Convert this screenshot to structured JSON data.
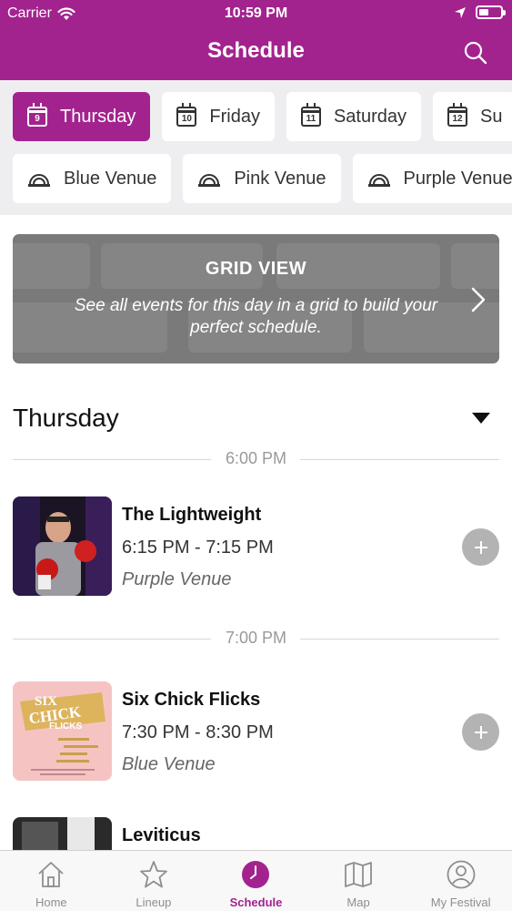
{
  "status_bar": {
    "carrier": "Carrier",
    "time": "10:59 PM",
    "battery_level": 0.45
  },
  "header": {
    "title": "Schedule"
  },
  "day_chips": [
    {
      "label": "Thursday",
      "day": "9",
      "active": true
    },
    {
      "label": "Friday",
      "day": "10",
      "active": false
    },
    {
      "label": "Saturday",
      "day": "11",
      "active": false
    },
    {
      "label": "Su",
      "day": "12",
      "active": false
    }
  ],
  "venue_chips": [
    {
      "label": "Blue Venue"
    },
    {
      "label": "Pink Venue"
    },
    {
      "label": "Purple Venue"
    }
  ],
  "grid_view": {
    "title": "GRID VIEW",
    "description": "See all events for this day in a grid to build your perfect schedule."
  },
  "day_section": {
    "title": "Thursday"
  },
  "time_slots": [
    {
      "label": "6:00 PM"
    },
    {
      "label": "7:00 PM"
    }
  ],
  "events": [
    {
      "title": "The Lightweight",
      "time": "6:15 PM - 7:15 PM",
      "venue": "Purple Venue"
    },
    {
      "title": "Six Chick Flicks",
      "time": "7:30 PM - 8:30 PM",
      "venue": "Blue Venue"
    },
    {
      "title": "Leviticus",
      "time": "",
      "venue": ""
    }
  ],
  "poster_text": {
    "line1": "SIX",
    "line2": "CHICK",
    "line3": "FLICKS"
  },
  "tabs": [
    {
      "label": "Home",
      "icon": "home-icon",
      "active": false
    },
    {
      "label": "Lineup",
      "icon": "star-icon",
      "active": false
    },
    {
      "label": "Schedule",
      "icon": "clock-icon",
      "active": true
    },
    {
      "label": "Map",
      "icon": "map-icon",
      "active": false
    },
    {
      "label": "My Festival",
      "icon": "user-icon",
      "active": false
    }
  ],
  "colors": {
    "brand": "#a3238e",
    "filter_bg": "#eeeef0",
    "banner": "#7a7a7a",
    "add_button": "#b3b3b3"
  }
}
